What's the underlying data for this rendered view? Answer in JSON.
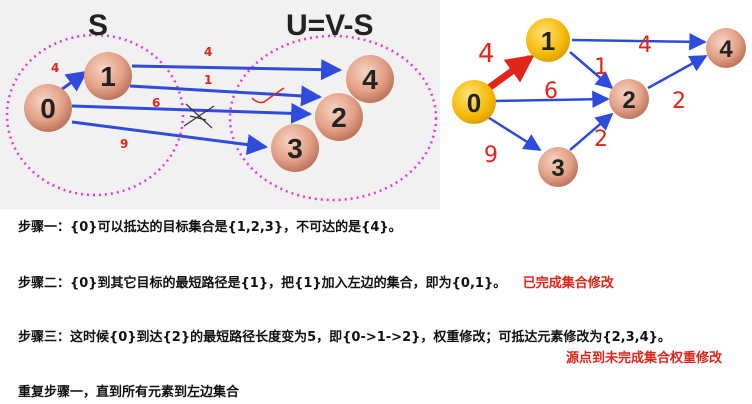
{
  "left_diagram": {
    "set_s_label": "S",
    "set_u_label": "U=V-S",
    "nodes": [
      "0",
      "1",
      "4",
      "2",
      "3"
    ],
    "edge_weights": [
      "4",
      "4",
      "1",
      "6",
      "9"
    ]
  },
  "right_diagram": {
    "nodes": [
      "0",
      "1",
      "2",
      "3",
      "4"
    ],
    "edge_weights": [
      "4",
      "6",
      "9",
      "1",
      "4",
      "2",
      "2"
    ]
  },
  "steps": [
    {
      "text": "步骤一：{0}可以抵达的目标集合是{1,2,3}，不可达的是{4}。",
      "note": ""
    },
    {
      "text": "步骤二：{0}到其它目标的最短路径是{1}，把{1}加入左边的集合，即为{0,1}。",
      "note": "已完成集合修改"
    },
    {
      "text": "步骤三：这时候{0}到达{2}的最短路径长度变为5，即{0->1->2}，权重修改；可抵达元素修改为{2,3,4}。",
      "note": ""
    },
    {
      "text": "重复步骤一，直到所有元素到左边集合",
      "note": ""
    }
  ],
  "step3_note": "源点到未完成集合权重修改",
  "colors": {
    "edge_blue": "#2f4bdc",
    "weight_red": "#e0251b",
    "node_fill": "#e8a98e",
    "source_fill": "#f5b800",
    "set_outline": "#ee34e8"
  }
}
